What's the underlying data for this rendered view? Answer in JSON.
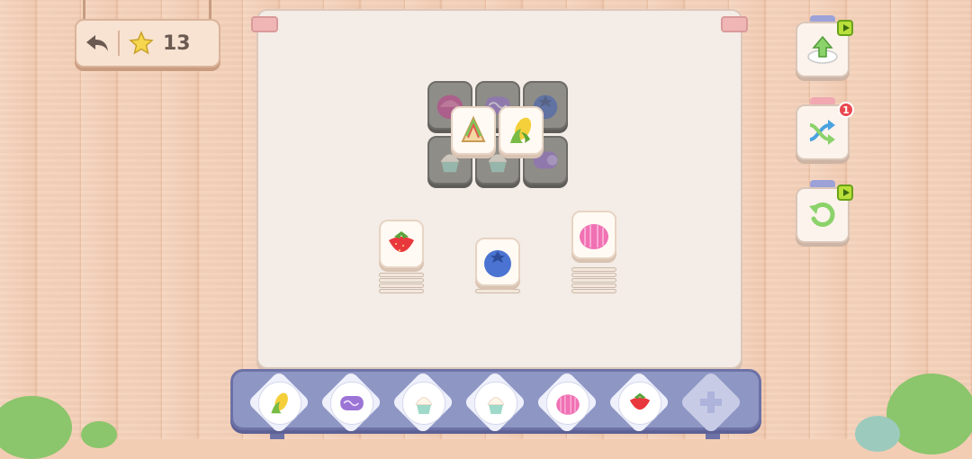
{
  "hud": {
    "back_icon": "undo-arrow-icon",
    "star_icon": "star-icon",
    "stars": "13"
  },
  "side_buttons": [
    {
      "name": "hint-button",
      "icon": "hint-plate-arrow-icon",
      "ad": true
    },
    {
      "name": "shuffle-button",
      "icon": "shuffle-icon",
      "badge": "1"
    },
    {
      "name": "undo-button",
      "icon": "undo-icon",
      "ad": true
    }
  ],
  "board": {
    "top_layer": [
      "sandwich",
      "corn"
    ],
    "blocked_tiles": [
      "jelly",
      "purple-roll",
      "blueberry",
      "cupcake",
      "cupcake",
      "purple-roll"
    ],
    "stacks": [
      {
        "item": "strawberry"
      },
      {
        "item": "blueberry"
      },
      {
        "item": "jelly"
      }
    ]
  },
  "tray": {
    "slots": [
      "corn",
      "purple-roll",
      "cupcake",
      "cupcake",
      "jelly",
      "strawberry",
      ""
    ],
    "empty_icon": "plus-icon"
  },
  "colors": {
    "accent_green": "#b9e03a",
    "badge_red": "#e9474f",
    "tray_blue": "#8e96c4"
  }
}
